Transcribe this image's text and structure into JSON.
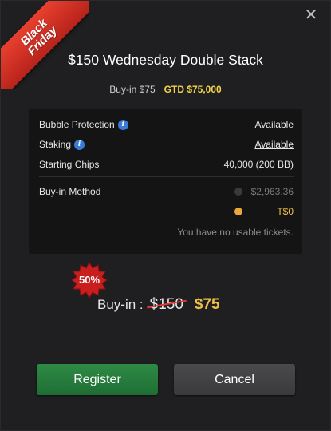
{
  "ribbon": {
    "line1": "Black",
    "line2": "Friday"
  },
  "dialog": {
    "title": "$150 Wednesday Double Stack",
    "buyin_label": "Buy-in $75",
    "gtd_label": "GTD $75,000"
  },
  "details": {
    "bubble_protection": {
      "label": "Bubble Protection",
      "value": "Available"
    },
    "staking": {
      "label": "Staking",
      "value": "Available"
    },
    "starting_chips": {
      "label": "Starting Chips",
      "value": "40,000 (200 BB)"
    },
    "buyin_method": {
      "label": "Buy-in Method",
      "options": [
        {
          "amount": "$2,963.36",
          "state": "disabled"
        },
        {
          "amount": "T$0",
          "state": "selected"
        }
      ],
      "note": "You have no usable tickets."
    }
  },
  "discount": {
    "badge": "50%",
    "label": "Buy-in :",
    "old_price": "$150",
    "new_price": "$75"
  },
  "buttons": {
    "register": "Register",
    "cancel": "Cancel"
  },
  "icons": {
    "close": "close-icon",
    "info": "info-icon"
  },
  "colors": {
    "gold": "#f0c048",
    "register": "#2f8a45",
    "link": "#4aa3ff",
    "strike": "#e43a3a"
  }
}
